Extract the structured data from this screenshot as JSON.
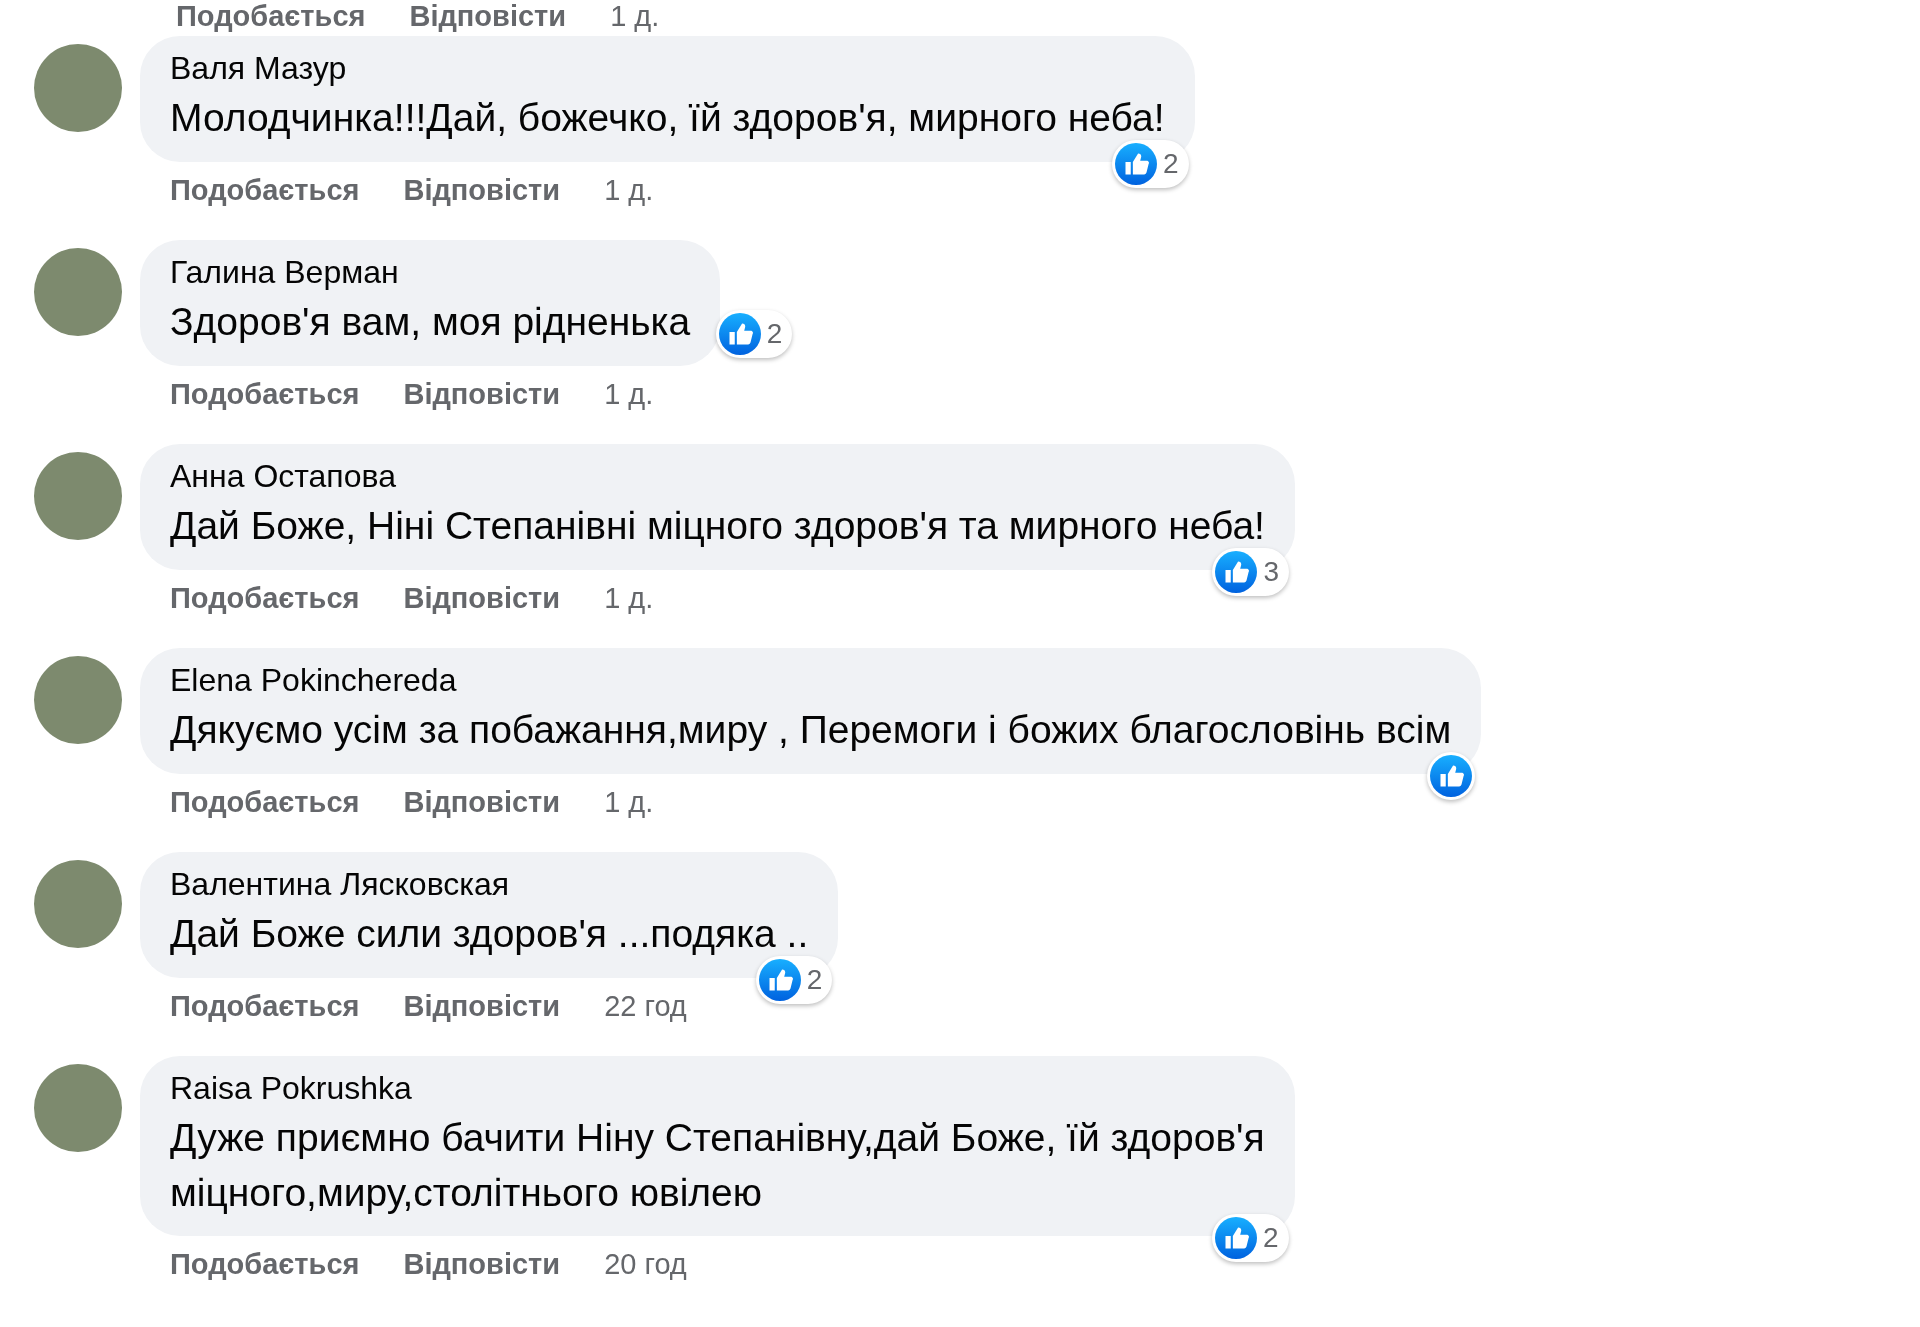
{
  "top_actions": {
    "like": "Подобається",
    "reply": "Відповісти",
    "time": "1 д."
  },
  "comments": [
    {
      "author": "Валя Мазур",
      "lines": [
        "Молодчинка!!!Дай, божечко, їй здоров'я, мирного неба!"
      ],
      "reactions": "2",
      "like": "Подобається",
      "reply": "Відповісти",
      "time": "1 д."
    },
    {
      "author": "Галина Верман",
      "lines": [
        "Здоров'я вам, моя рідненька"
      ],
      "reactions": "2",
      "like": "Подобається",
      "reply": "Відповісти",
      "time": "1 д."
    },
    {
      "author": "Анна Остапова",
      "lines": [
        "Дай Боже, Ніні Степанівні міцного здоров'я та мирного неба!"
      ],
      "reactions": "3",
      "like": "Подобається",
      "reply": "Відповісти",
      "time": "1 д."
    },
    {
      "author": "Elena Pokinchereda",
      "lines": [
        "Дякуємо усім за побажання,миру , Перемоги і божих благословінь всім"
      ],
      "like": "Подобається",
      "reply": "Відповісти",
      "time": "1 д."
    },
    {
      "author": "Валентина Лясковская",
      "lines": [
        "Дай Боже сили здоров'я ...подяка .."
      ],
      "reactions": "2",
      "like": "Подобається",
      "reply": "Відповісти",
      "time": "22 год"
    },
    {
      "author": "Raisa Pokrushka",
      "lines": [
        "Дуже приємно бачити Ніну Степанівну,дай Боже, їй здоров'я",
        "міцного,миру,столітнього ювілею"
      ],
      "reactions": "2",
      "like": "Подобається",
      "reply": "Відповісти",
      "time": "20 год"
    }
  ]
}
